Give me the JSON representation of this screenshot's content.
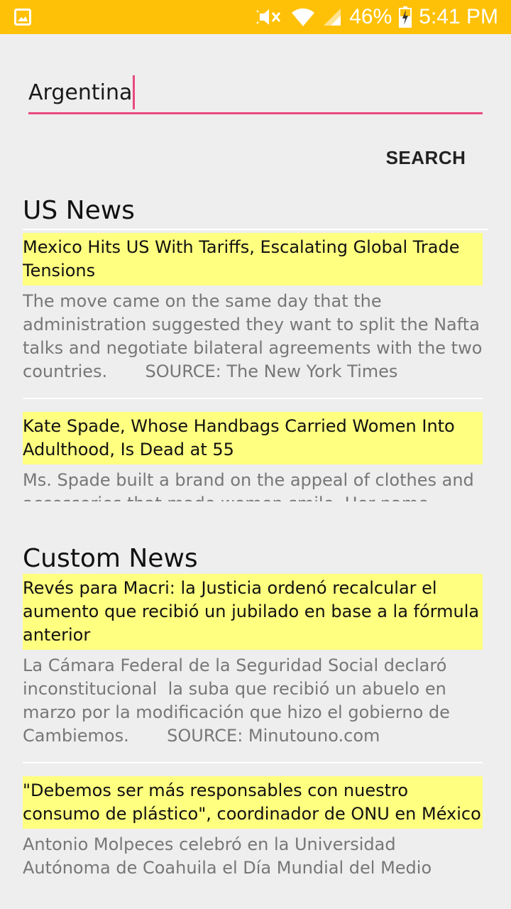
{
  "status_bar": {
    "battery_percent": "46%",
    "time": "5:41 PM"
  },
  "search": {
    "value": "Argentina",
    "button_label": "SEARCH"
  },
  "sections": [
    {
      "title": "US News",
      "items": [
        {
          "headline": "Mexico Hits US With Tariffs, Escalating Global Trade Tensions",
          "summary": "The move came on the same day that the administration suggested they want to split the Nafta talks and negotiate bilateral agreements with the two countries.       SOURCE: The New York Times"
        },
        {
          "headline": "Kate Spade, Whose Handbags Carried Women Into Adulthood, Is Dead at 55",
          "summary": "Ms. Spade built a brand on the appeal of clothes and accessories that made women smile. Her name"
        }
      ]
    },
    {
      "title": "Custom News",
      "items": [
        {
          "headline": "Revés para Macri: la Justicia ordenó recalcular el aumento que recibió un jubilado en base a la fórmula anterior",
          "summary": "La Cámara Federal de la Seguridad Social declaró inconstitucional  la suba que recibió un abuelo en marzo por la modificación que hizo el gobierno de Cambiemos.       SOURCE: Minutouno.com"
        },
        {
          "headline": "\"Debemos ser más responsables con nuestro consumo de plástico\", coordinador de ONU en México",
          "summary": "Antonio Molpeces celebró en la Universidad Autónoma de Coahuila el Día Mundial del Medio"
        }
      ]
    }
  ]
}
